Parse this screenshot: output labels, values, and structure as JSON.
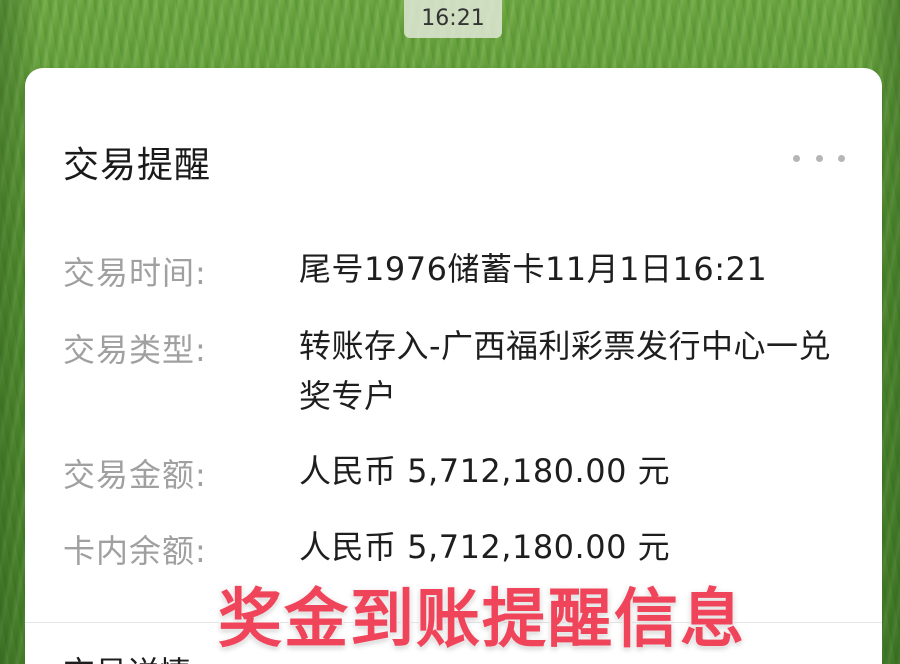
{
  "status_time": "16:21",
  "card": {
    "title": "交易提醒",
    "more_icon": "more-horizontal-icon",
    "rows": [
      {
        "label": "交易时间:",
        "value": "尾号1976储蓄卡11月1日16:21"
      },
      {
        "label": "交易类型:",
        "value": "转账存入-广西福利彩票发行中心一兑奖专户"
      },
      {
        "label": "交易金额:",
        "value": "人民币 5,712,180.00 元"
      },
      {
        "label": "卡内余额:",
        "value": "人民币 5,712,180.00 元"
      }
    ],
    "detail_link": "交易详情"
  },
  "overlay_caption": "奖金到账提醒信息",
  "colors": {
    "caption": "#f0445a",
    "background": "#5d9a35",
    "card": "#ffffff",
    "label": "#a0a0a0"
  }
}
